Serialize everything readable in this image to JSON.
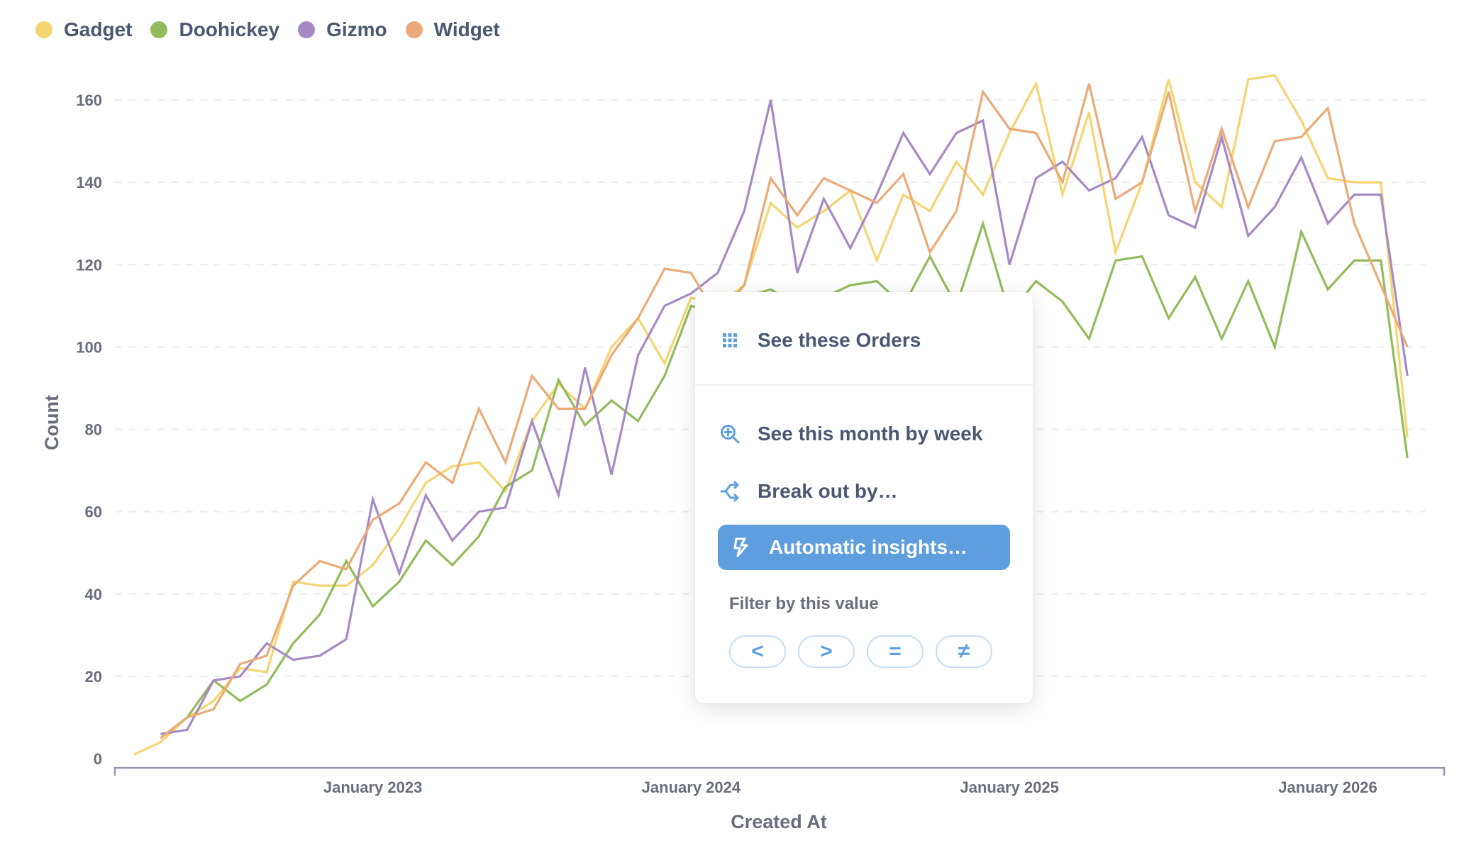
{
  "legend": [
    {
      "name": "Gadget",
      "color": "#f5d571"
    },
    {
      "name": "Doohickey",
      "color": "#92bc5c"
    },
    {
      "name": "Gizmo",
      "color": "#a68ac4"
    },
    {
      "name": "Widget",
      "color": "#ebaa78"
    }
  ],
  "chart_data": {
    "type": "line",
    "title": "",
    "xlabel": "Created At",
    "ylabel": "Count",
    "ylim": [
      0,
      160
    ],
    "yticks": [
      0,
      20,
      40,
      60,
      80,
      100,
      120,
      140,
      160
    ],
    "grid": true,
    "legend_position": "top-left",
    "x_tick_labels": [
      {
        "label": "January 2023",
        "month": "2023-01"
      },
      {
        "label": "January 2024",
        "month": "2024-01"
      },
      {
        "label": "January 2025",
        "month": "2025-01"
      },
      {
        "label": "January 2026",
        "month": "2026-01"
      }
    ],
    "x": [
      "2022-04",
      "2022-05",
      "2022-06",
      "2022-07",
      "2022-08",
      "2022-09",
      "2022-10",
      "2022-11",
      "2022-12",
      "2023-01",
      "2023-02",
      "2023-03",
      "2023-04",
      "2023-05",
      "2023-06",
      "2023-07",
      "2023-08",
      "2023-09",
      "2023-10",
      "2023-11",
      "2023-12",
      "2024-01",
      "2024-02",
      "2024-03",
      "2024-04",
      "2024-05",
      "2024-06",
      "2024-07",
      "2024-08",
      "2024-09",
      "2024-10",
      "2024-11",
      "2024-12",
      "2025-01",
      "2025-02",
      "2025-03",
      "2025-04",
      "2025-05",
      "2025-06",
      "2025-07",
      "2025-08",
      "2025-09",
      "2025-10",
      "2025-11",
      "2025-12",
      "2026-01",
      "2026-02",
      "2026-03",
      "2026-04"
    ],
    "series": [
      {
        "name": "Gadget",
        "color": "#f5d571",
        "values": [
          1,
          4,
          10,
          14,
          22,
          21,
          43,
          42,
          42,
          47,
          56,
          67,
          71,
          72,
          65,
          82,
          91,
          85,
          100,
          107,
          96,
          112,
          110,
          115,
          135,
          129,
          133,
          138,
          121,
          137,
          133,
          145,
          137,
          152,
          164,
          137,
          157,
          123,
          140,
          165,
          140,
          134,
          165,
          166,
          155,
          141,
          140,
          140,
          78
        ]
      },
      {
        "name": "Doohickey",
        "color": "#92bc5c",
        "values": [
          null,
          5,
          10,
          19,
          14,
          18,
          28,
          35,
          48,
          37,
          43,
          53,
          47,
          54,
          66,
          70,
          92,
          81,
          87,
          82,
          93,
          110,
          108,
          112,
          114,
          110,
          112,
          115,
          116,
          110,
          122,
          110,
          130,
          108,
          116,
          111,
          102,
          121,
          122,
          107,
          117,
          102,
          116,
          100,
          128,
          114,
          121,
          121,
          73
        ]
      },
      {
        "name": "Gizmo",
        "color": "#a68ac4",
        "values": [
          null,
          6,
          7,
          19,
          20,
          28,
          24,
          25,
          29,
          63,
          45,
          64,
          53,
          60,
          61,
          82,
          64,
          95,
          69,
          98,
          110,
          113,
          118,
          133,
          160,
          118,
          136,
          124,
          137,
          152,
          142,
          152,
          155,
          120,
          141,
          145,
          138,
          141,
          151,
          132,
          129,
          151,
          127,
          134,
          146,
          130,
          137,
          137,
          93
        ]
      },
      {
        "name": "Widget",
        "color": "#ebaa78",
        "values": [
          null,
          5,
          10,
          12,
          23,
          25,
          42,
          48,
          46,
          58,
          62,
          72,
          67,
          85,
          72,
          93,
          85,
          85,
          98,
          107,
          119,
          118,
          107,
          115,
          141,
          132,
          141,
          138,
          135,
          142,
          123,
          133,
          162,
          153,
          152,
          140,
          164,
          136,
          140,
          162,
          133,
          153,
          134,
          150,
          151,
          158,
          130,
          115,
          100
        ]
      }
    ]
  },
  "popup": {
    "items": [
      {
        "label": "See these Orders",
        "icon": "grid-icon"
      },
      {
        "label": "See this month by week",
        "icon": "zoom-in-icon"
      },
      {
        "label": "Break out by…",
        "icon": "branch-icon"
      },
      {
        "label": "Automatic insights…",
        "icon": "bolt-icon"
      }
    ],
    "filter_title": "Filter by this value",
    "filter_buttons": [
      "<",
      ">",
      "=",
      "≠"
    ],
    "accent": "#5f9ede"
  }
}
